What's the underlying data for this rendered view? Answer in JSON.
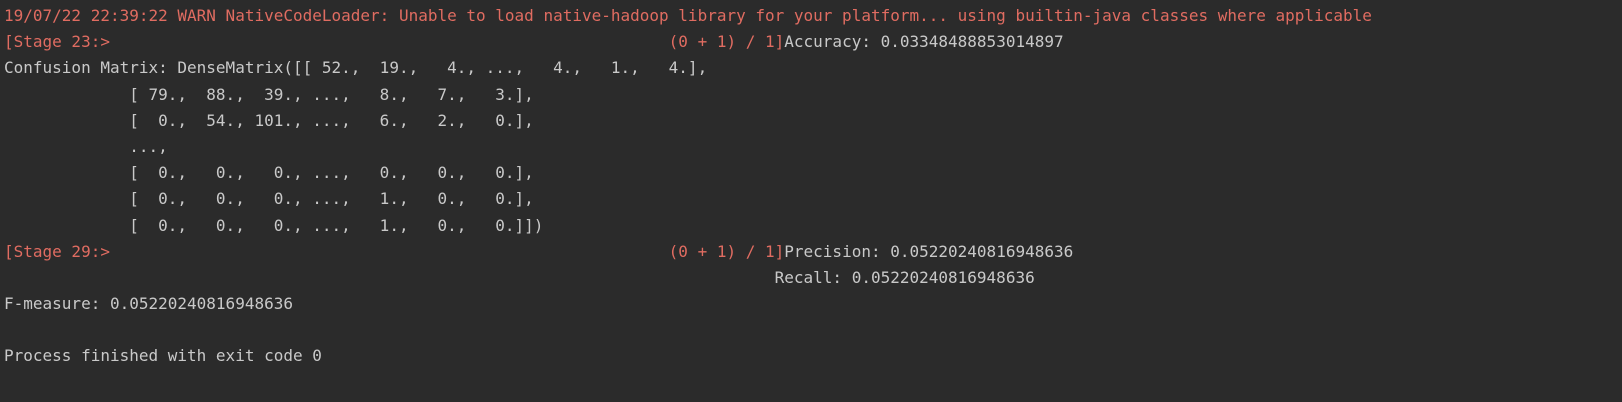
{
  "console": {
    "lines": [
      {
        "segments": [
          {
            "text": "19/07/22 22:39:22 WARN NativeCodeLoader: Unable to load native-hadoop library for your platform... using builtin-java classes where applicable",
            "stream": "stderr"
          }
        ]
      },
      {
        "segments": [
          {
            "text": "[Stage 23:>                                                          (0 + 1) / 1]",
            "stream": "stderr"
          },
          {
            "text": "Accuracy: 0.03348488853014897",
            "stream": "stdout"
          }
        ]
      },
      {
        "segments": [
          {
            "text": "Confusion Matrix: DenseMatrix([[ 52.,  19.,   4., ...,   4.,   1.,   4.],",
            "stream": "stdout"
          }
        ]
      },
      {
        "segments": [
          {
            "text": "             [ 79.,  88.,  39., ...,   8.,   7.,   3.],",
            "stream": "stdout"
          }
        ]
      },
      {
        "segments": [
          {
            "text": "             [  0.,  54., 101., ...,   6.,   2.,   0.],",
            "stream": "stdout"
          }
        ]
      },
      {
        "segments": [
          {
            "text": "             ...,",
            "stream": "stdout"
          }
        ]
      },
      {
        "segments": [
          {
            "text": "             [  0.,   0.,   0., ...,   0.,   0.,   0.],",
            "stream": "stdout"
          }
        ]
      },
      {
        "segments": [
          {
            "text": "             [  0.,   0.,   0., ...,   1.,   0.,   0.],",
            "stream": "stdout"
          }
        ]
      },
      {
        "segments": [
          {
            "text": "             [  0.,   0.,   0., ...,   1.,   0.,   0.]])",
            "stream": "stdout"
          }
        ]
      },
      {
        "segments": [
          {
            "text": "[Stage 29:>                                                          (0 + 1) / 1]",
            "stream": "stderr"
          },
          {
            "text": "Precision: 0.05220240816948636",
            "stream": "stdout"
          }
        ]
      },
      {
        "segments": [
          {
            "text": "                                                                                Recall: 0.05220240816948636",
            "stream": "stdout"
          }
        ]
      },
      {
        "segments": [
          {
            "text": "F-measure: 0.05220240816948636",
            "stream": "stdout"
          }
        ]
      },
      {
        "segments": [
          {
            "text": "",
            "stream": "stdout"
          }
        ]
      },
      {
        "segments": [
          {
            "text": "Process finished with exit code 0",
            "stream": "stdout"
          }
        ]
      }
    ]
  },
  "colors": {
    "background": "#2b2b2b",
    "stdout": "#c9c9c9",
    "stderr": "#e06c61"
  }
}
